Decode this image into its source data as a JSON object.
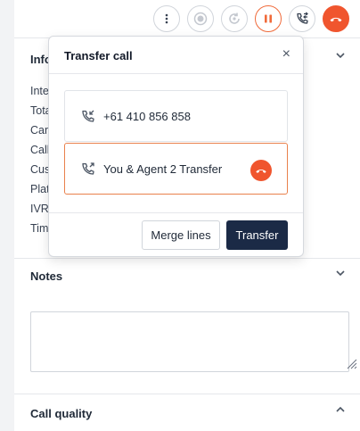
{
  "toolbar": {
    "buttons": [
      {
        "icon": "more-vertical-icon"
      },
      {
        "icon": "record-icon"
      },
      {
        "icon": "refresh-call-icon"
      },
      {
        "icon": "pause-icon"
      },
      {
        "icon": "transfer-icon"
      },
      {
        "icon": "hangup-icon"
      }
    ],
    "accent_color": "#f0552e"
  },
  "info": {
    "title": "Info",
    "rows": [
      "Inter",
      "Total",
      "Cam",
      "Call",
      "Cus",
      "Plat",
      "IVR",
      "Tim"
    ]
  },
  "notes": {
    "title": "Notes",
    "value": "",
    "placeholder": ""
  },
  "call_quality": {
    "title": "Call quality"
  },
  "transfer_popover": {
    "title": "Transfer call",
    "close_label": "×",
    "lines": [
      {
        "label": "+61 410 856 858",
        "icon": "call-incoming-icon",
        "active": false
      },
      {
        "label": "You & Agent 2 Transfer",
        "icon": "call-outgoing-icon",
        "active": true
      }
    ],
    "merge_label": "Merge lines",
    "transfer_label": "Transfer",
    "primary_color": "#1b2a46"
  }
}
